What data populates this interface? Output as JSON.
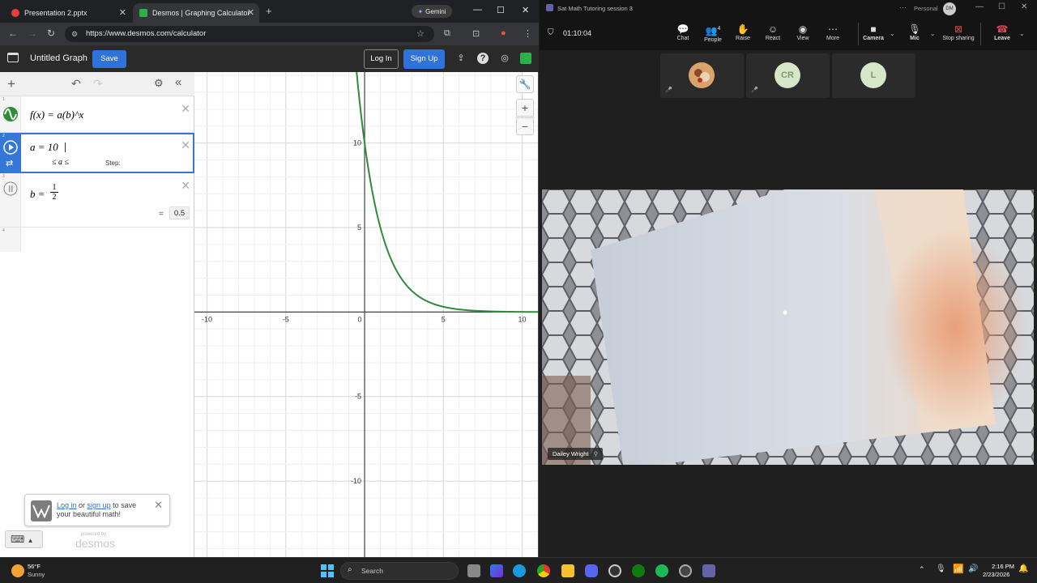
{
  "browser": {
    "tabs": [
      {
        "label": "Presentation 2.pptx",
        "favicon_color": "#e5413a"
      },
      {
        "label": "Desmos | Graphing Calculator",
        "favicon_color": "#2bb14c"
      }
    ],
    "gemini_label": "Gemini",
    "url": "https://www.desmos.com/calculator"
  },
  "desmos": {
    "graph_title": "Untitled Graph",
    "save_label": "Save",
    "login_label": "Log In",
    "signup_label": "Sign Up",
    "expressions": [
      {
        "num": "1",
        "latex": "f(x) = a(b)^x"
      },
      {
        "num": "2",
        "lhs": "a = 10",
        "slider_bounds_label": "≤ a ≤",
        "step_label": "Step:"
      },
      {
        "num": "3",
        "lhs": "b = ",
        "frac_num": "1",
        "frac_den": "2",
        "eval_eq": "=",
        "eval_value": "0.5"
      },
      {
        "num": "4"
      }
    ],
    "toast": {
      "login": "Log in",
      "or": " or ",
      "signup": "sign up",
      "rest": " to save",
      "line2": "your beautiful math!"
    },
    "powered_by": "powered by",
    "brand": "desmos",
    "curve_color": "#2d8c3c"
  },
  "chart_data": {
    "type": "line",
    "title": "",
    "xlabel": "",
    "ylabel": "",
    "xlim": [
      -10.8,
      11.0
    ],
    "ylim": [
      -14.5,
      14.2
    ],
    "x_ticks": [
      -10,
      -5,
      0,
      5,
      10
    ],
    "y_ticks": [
      -10,
      -5,
      5,
      10
    ],
    "grid": true,
    "series": [
      {
        "function": "10 * 0.5^x",
        "a": 10,
        "b": 0.5,
        "color": "#2d8c3c"
      }
    ]
  },
  "teams": {
    "window_title": "Sat Math Tutoring session 3",
    "personal_label": "Personal",
    "personal_initials": "DM",
    "timer": "01:10:04",
    "toolbar": [
      {
        "label": "Chat",
        "icon": "chat-icon",
        "glyph": "💬"
      },
      {
        "label": "People",
        "icon": "people-icon",
        "glyph": "👥",
        "badge": "4"
      },
      {
        "label": "Raise",
        "icon": "raise-hand-icon",
        "glyph": "✋"
      },
      {
        "label": "React",
        "icon": "react-icon",
        "glyph": "☺"
      },
      {
        "label": "View",
        "icon": "view-icon",
        "glyph": "◉"
      },
      {
        "label": "More",
        "icon": "more-icon",
        "glyph": "⋯"
      }
    ],
    "camera_label": "Camera",
    "mic_label": "Mic",
    "share_label": "Stop sharing",
    "leave_label": "Leave",
    "participants": [
      {
        "initials": "",
        "bg": "#c98a4a"
      },
      {
        "initials": "CR",
        "bg": "#d6e6c8"
      },
      {
        "initials": "L",
        "bg": "#d6e6c8"
      }
    ],
    "presenter_name": "Dailey Wright"
  },
  "taskbar": {
    "weather_temp": "56°F",
    "weather_desc": "Sunny",
    "search_placeholder": "Search",
    "time": "2:16 PM",
    "date": "2/23/2026"
  }
}
